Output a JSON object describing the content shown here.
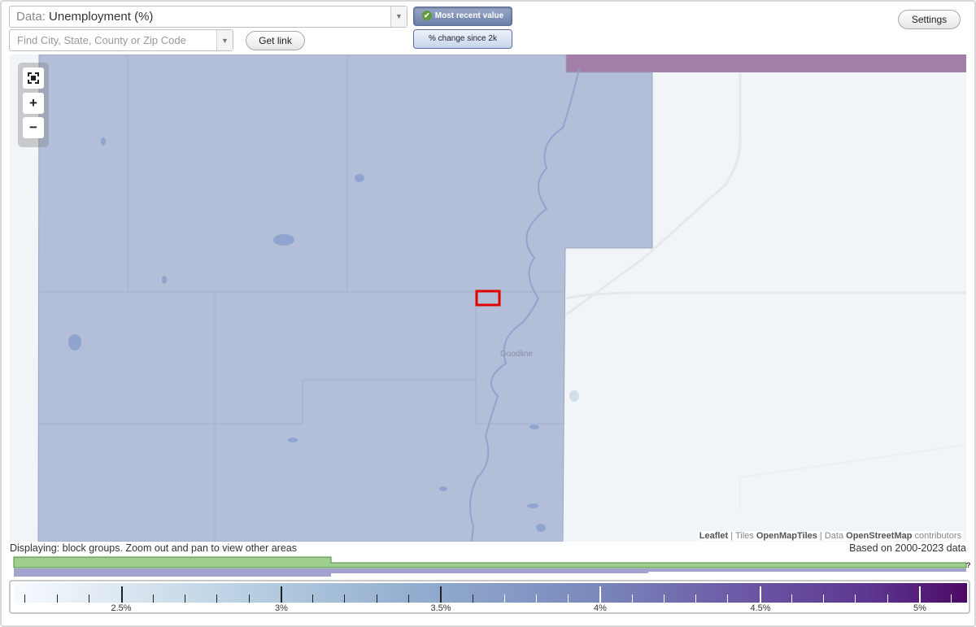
{
  "controls": {
    "data_prefix": "Data:",
    "data_value": "Unemployment (%)",
    "search_placeholder": "Find City, State, County or Zip Code",
    "get_link": "Get link",
    "toggle_active": "Most recent value",
    "toggle_inactive": "% change since 2k",
    "settings": "Settings"
  },
  "map": {
    "place_label": "Goodline",
    "zoom_fit_icon": "fullscreen-icon",
    "zoom_in": "+",
    "zoom_out": "−",
    "colors": {
      "region_fill": "#b3bfd9",
      "region_border": "#9aa6c2",
      "top_band": "#a27fa6",
      "empty_area": "#f2f5f7",
      "water": "#8fa5cf",
      "highlight": "#e00000"
    }
  },
  "attribution": {
    "leaflet": "Leaflet",
    "tiles_prefix": "Tiles",
    "tiles_source": "OpenMapTiles",
    "data_prefix": "Data",
    "data_source": "OpenStreetMap",
    "data_suffix": "contributors"
  },
  "footer": {
    "display_note": "Displaying: block groups. Zoom out and pan to view other areas",
    "based_on": "Based on 2000-2023 data",
    "help": "?"
  },
  "legend": {
    "ticks": [
      "2.5%",
      "3%",
      "3.5%",
      "4%",
      "4.5%",
      "5%"
    ],
    "colors": {
      "histogram_green": "#9fcf8e",
      "histogram_purple": "#a3a3d0"
    }
  }
}
